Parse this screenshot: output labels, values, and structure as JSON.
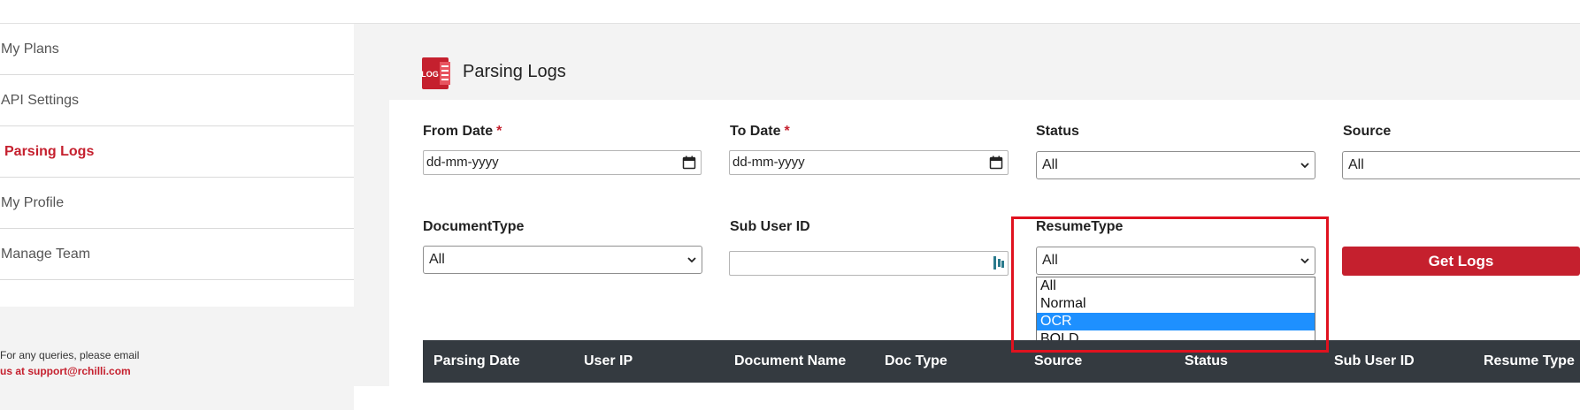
{
  "sidebar": {
    "items": [
      {
        "label": "My Plans"
      },
      {
        "label": "API Settings"
      },
      {
        "label": "Parsing Logs"
      },
      {
        "label": "My Profile"
      },
      {
        "label": "Manage Team"
      }
    ],
    "footer": {
      "line1": "For any queries, please email",
      "line2": "us at support@rchilli.com"
    }
  },
  "main": {
    "icon": "log-document-icon",
    "title": "Parsing Logs",
    "icon_text": "LOG"
  },
  "filters": {
    "from_date": {
      "label": "From Date",
      "required": "*",
      "value": "dd-mm-yyyy"
    },
    "to_date": {
      "label": "To Date",
      "required": "*",
      "value": "dd-mm-yyyy"
    },
    "status": {
      "label": "Status",
      "value": "All"
    },
    "source": {
      "label": "Source",
      "value": "All"
    },
    "document_type": {
      "label": "DocumentType",
      "value": "All"
    },
    "sub_user_id": {
      "label": "Sub User ID",
      "value": ""
    },
    "resume_type": {
      "label": "ResumeType",
      "value": "All",
      "options": [
        "All",
        "Normal",
        "OCR",
        "BOLD"
      ],
      "highlighted": "OCR"
    },
    "get_logs_label": "Get Logs"
  },
  "table": {
    "headers": [
      "Parsing Date",
      "User IP",
      "Document Name",
      "Doc Type",
      "Source",
      "Status",
      "Sub User ID",
      "Resume Type"
    ]
  },
  "colors": {
    "accent": "#c5202e",
    "table_header": "#343a40",
    "option_highlight": "#1e90ff",
    "annotation": "#e0121f"
  }
}
